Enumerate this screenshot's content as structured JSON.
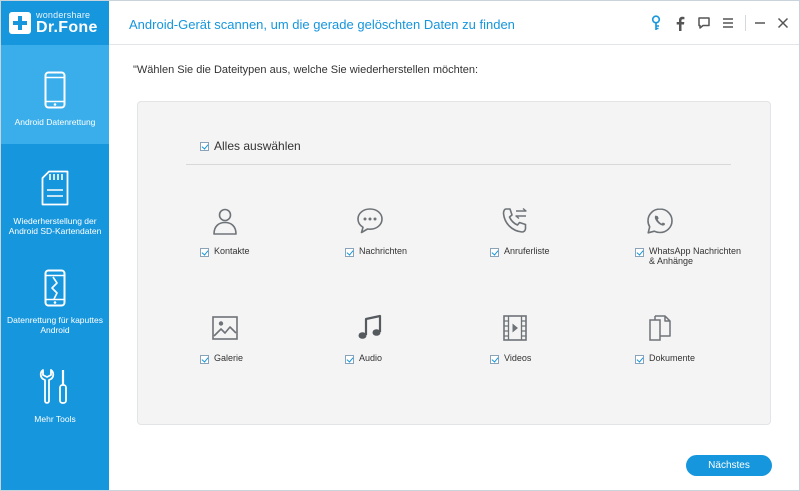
{
  "app": {
    "brand_small": "wondershare",
    "brand_name": "Dr.Fone",
    "header_title": "Android-Gerät scannen, um die gerade gelöschten Daten zu finden"
  },
  "toolbar": {
    "icons": [
      "key-icon",
      "facebook-icon",
      "feedback-icon",
      "menu-icon",
      "minimize-icon",
      "close-icon"
    ]
  },
  "sidebar": {
    "items": [
      {
        "label": "Android Datenrettung",
        "icon": "phone-icon",
        "active": true
      },
      {
        "label": "Wiederherstellung der Android SD-Kartendaten",
        "icon": "sd-card-icon",
        "active": false
      },
      {
        "label": "Datenrettung für kaputtes Android",
        "icon": "broken-phone-icon",
        "active": false
      },
      {
        "label": "Mehr Tools",
        "icon": "tools-icon",
        "active": false
      }
    ]
  },
  "main": {
    "prompt": "\"Wählen Sie die Dateitypen aus, welche Sie wiederherstellen möchten:",
    "select_all": {
      "label": "Alles auswählen",
      "checked": true
    },
    "file_types": [
      {
        "label": "Kontakte",
        "icon": "contact-icon",
        "checked": true
      },
      {
        "label": "Nachrichten",
        "icon": "message-icon",
        "checked": true
      },
      {
        "label": "Anruferliste",
        "icon": "call-log-icon",
        "checked": true
      },
      {
        "label": "WhatsApp Nachrichten & Anhänge",
        "icon": "whatsapp-icon",
        "checked": true
      },
      {
        "label": "Galerie",
        "icon": "gallery-icon",
        "checked": true
      },
      {
        "label": "Audio",
        "icon": "music-icon",
        "checked": true
      },
      {
        "label": "Videos",
        "icon": "video-icon",
        "checked": true
      },
      {
        "label": "Dokumente",
        "icon": "document-icon",
        "checked": true
      }
    ],
    "next_label": "Nächstes"
  },
  "colors": {
    "accent": "#1596dd",
    "sidebar_active": "#39aeea",
    "icon_gray": "#6e7378"
  }
}
